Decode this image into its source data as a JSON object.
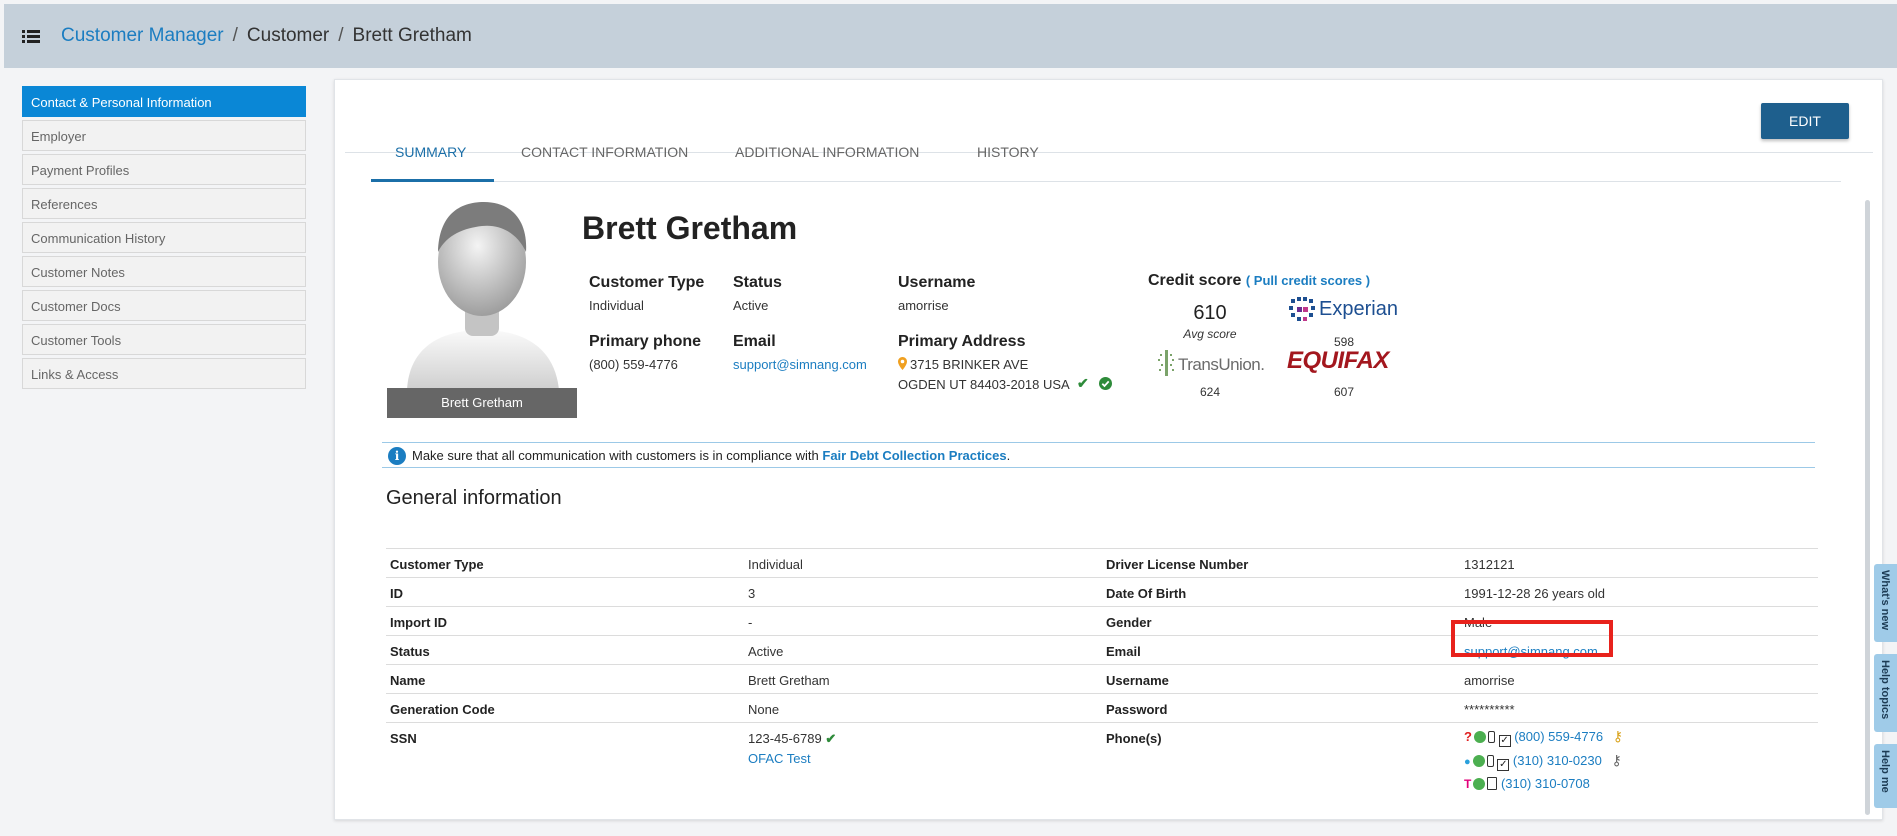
{
  "breadcrumb": {
    "root": "Customer Manager",
    "section": "Customer",
    "current": "Brett Gretham",
    "sep": "/"
  },
  "sidebar": {
    "items": [
      {
        "label": "Contact & Personal Information",
        "active": true
      },
      {
        "label": "Employer"
      },
      {
        "label": "Payment Profiles"
      },
      {
        "label": "References"
      },
      {
        "label": "Communication History"
      },
      {
        "label": "Customer Notes"
      },
      {
        "label": "Customer Docs"
      },
      {
        "label": "Customer Tools"
      },
      {
        "label": "Links & Access"
      }
    ]
  },
  "toolbar": {
    "edit_label": "EDIT"
  },
  "tabs": [
    "SUMMARY",
    "CONTACT INFORMATION",
    "ADDITIONAL INFORMATION",
    "HISTORY"
  ],
  "summary": {
    "avatar_label": "Brett Gretham",
    "name": "Brett Gretham",
    "customer_type_label": "Customer Type",
    "customer_type": "Individual",
    "status_label": "Status",
    "status": "Active",
    "username_label": "Username",
    "username": "amorrise",
    "primary_phone_label": "Primary phone",
    "primary_phone": "(800) 559-4776",
    "email_label": "Email",
    "email": "support@simnang.com",
    "address_label": "Primary Address",
    "address_line1": "3715 BRINKER AVE",
    "address_line2": "OGDEN UT 84403-2018 USA"
  },
  "credit": {
    "title": "Credit score",
    "pull_link": "( Pull credit scores )",
    "avg_score": "610",
    "avg_label": "Avg score",
    "experian_name": "Experian",
    "experian_score": "598",
    "transunion_name": "TransUnion.",
    "transunion_score": "624",
    "equifax_name": "EQUIFAX",
    "equifax_score": "607"
  },
  "notice": {
    "text": "Make sure that all communication with customers is in compliance with ",
    "link": "Fair Debt Collection Practices",
    "suffix": "."
  },
  "general": {
    "title": "General information",
    "rows": [
      {
        "k1": "Customer Type",
        "v1": "Individual",
        "k2": "Driver License Number",
        "v2": "1312121"
      },
      {
        "k1": "ID",
        "v1": "3",
        "k2": "Date Of Birth",
        "v2": "1991-12-28 26 years old"
      },
      {
        "k1": "Import ID",
        "v1": "-",
        "k2": "Gender",
        "v2": "Male"
      },
      {
        "k1": "Status",
        "v1": "Active",
        "k2": "Email",
        "v2": "support@simnang.com"
      },
      {
        "k1": "Name",
        "v1": "Brett Gretham",
        "k2": "Username",
        "v2": "amorrise"
      },
      {
        "k1": "Generation Code",
        "v1": "None",
        "k2": "Password",
        "v2": "**********"
      }
    ],
    "ssn_label": "SSN",
    "ssn": "123-45-6789",
    "ofac_link": "OFAC Test",
    "phones_label": "Phone(s)",
    "phones": [
      "(800) 559-4776",
      "(310) 310-0230",
      "(310) 310-0708"
    ]
  },
  "float_tabs": [
    "What's new",
    "Help topics",
    "Help me"
  ],
  "colors": {
    "accent": "#0a87d6",
    "link": "#1b7dc1",
    "edit": "#1e5f8d",
    "topbar": "#c5d0da",
    "highlight": "#e8221c"
  }
}
